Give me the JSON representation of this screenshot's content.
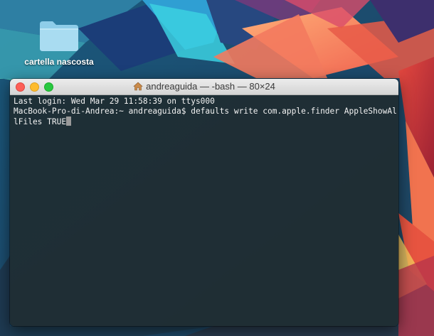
{
  "desktop": {
    "folder": {
      "label": "cartella nascosta",
      "icon": "folder-icon"
    }
  },
  "terminal": {
    "title": "andreaguida — -bash — 80×24",
    "title_icon": "home-icon",
    "lines": [
      "Last login: Wed Mar 29 11:58:39 on ttys000",
      "MacBook-Pro-di-Andrea:~ andreaguida$ defaults write com.apple.finder AppleShowAl",
      "lFiles TRUE"
    ],
    "colors": {
      "close": "#fd5f57",
      "minimize": "#febc2e",
      "zoom": "#28c840"
    }
  }
}
